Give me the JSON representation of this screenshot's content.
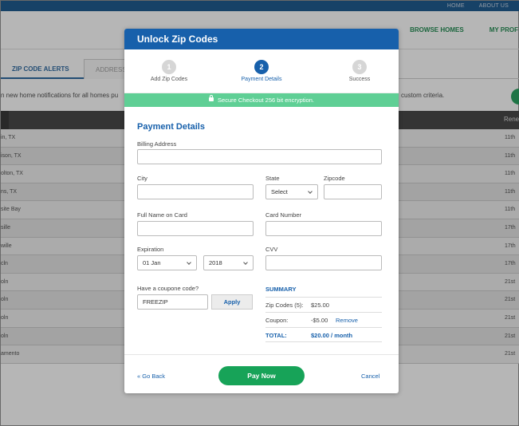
{
  "topbar": {
    "links": [
      "HOME",
      "ABOUT US"
    ]
  },
  "nav": {
    "items": [
      "BROWSE HOMES",
      "MY PROF"
    ]
  },
  "tabs": {
    "active": "ZIP CODE ALERTS",
    "other": "ADDRESS"
  },
  "page": {
    "description": "n new home notifications for all homes pu",
    "description_right": "custom criteria.",
    "table_header_right": "Rene"
  },
  "rows": [
    {
      "city": "in, TX",
      "date": "11th"
    },
    {
      "city": "ison, TX",
      "date": "11th"
    },
    {
      "city": "olton, TX",
      "date": "11th"
    },
    {
      "city": "ns, TX",
      "date": "11th"
    },
    {
      "city": "site Bay",
      "date": "11th"
    },
    {
      "city": "sille",
      "date": "17th"
    },
    {
      "city": "wille",
      "date": "17th"
    },
    {
      "city": "cln",
      "date": "17th"
    },
    {
      "city": "oln",
      "date": "21st"
    },
    {
      "city": "oln",
      "date": "21st"
    },
    {
      "city": "oln",
      "date": "21st"
    },
    {
      "city": "oln",
      "date": "21st"
    },
    {
      "city": "amento",
      "date": "21st"
    }
  ],
  "modal": {
    "title": "Unlock Zip Codes",
    "steps": [
      {
        "number": "1",
        "label": "Add Zip Codes",
        "state": "inactive"
      },
      {
        "number": "2",
        "label": "Payment Details",
        "state": "active"
      },
      {
        "number": "3",
        "label": "Success",
        "state": "inactive"
      }
    ],
    "secure_text": "Secure Checkout 256 bit encryption.",
    "section_title": "Payment Details",
    "labels": {
      "billing_address": "Billing Address",
      "city": "City",
      "state": "State",
      "zipcode": "Zipcode",
      "full_name": "Full Name on Card",
      "card_number": "Card Number",
      "expiration": "Expiration",
      "cvv": "CVV",
      "coupon": "Have a coupone code?"
    },
    "values": {
      "state": "Select",
      "exp_month": "01  Jan",
      "exp_year": "2018",
      "coupon": "FREEZIP"
    },
    "apply_label": "Apply",
    "summary": {
      "title": "SUMMARY",
      "zip_label": "Zip Codes (5):",
      "zip_value": "$25.00",
      "coupon_label": "Coupon:",
      "coupon_value": "-$5.00",
      "remove_label": "Remove",
      "total_label": "TOTAL:",
      "total_value": "$20.00 / month"
    },
    "footer": {
      "back_label": "« Go Back",
      "pay_label": "Pay Now",
      "cancel_label": "Cancel"
    }
  },
  "colors": {
    "brand_blue": "#1760ab",
    "secure_green": "#5fcf95",
    "pay_green": "#17a358"
  }
}
